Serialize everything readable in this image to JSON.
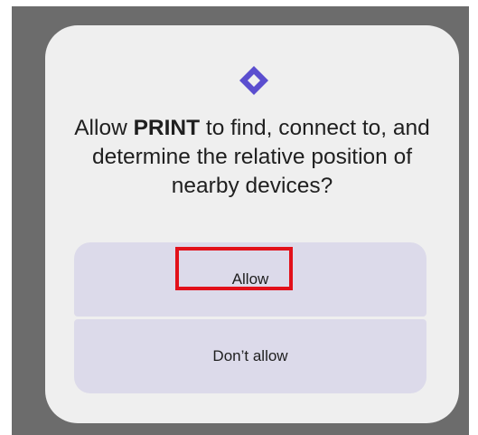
{
  "dialog": {
    "icon": "nearby-devices-icon",
    "message": {
      "prefix": "Allow ",
      "app_name": "PRINT",
      "suffix": " to find, connect to, and determine the relative position of nearby devices?"
    },
    "allow_label": "Allow",
    "deny_label": "Don’t allow"
  },
  "colors": {
    "scrim": "#6c6c6c",
    "dialog_bg": "#efefef",
    "button_bg": "#dcdaea",
    "icon_accent": "#5b4ecf",
    "highlight": "#e2101a"
  }
}
